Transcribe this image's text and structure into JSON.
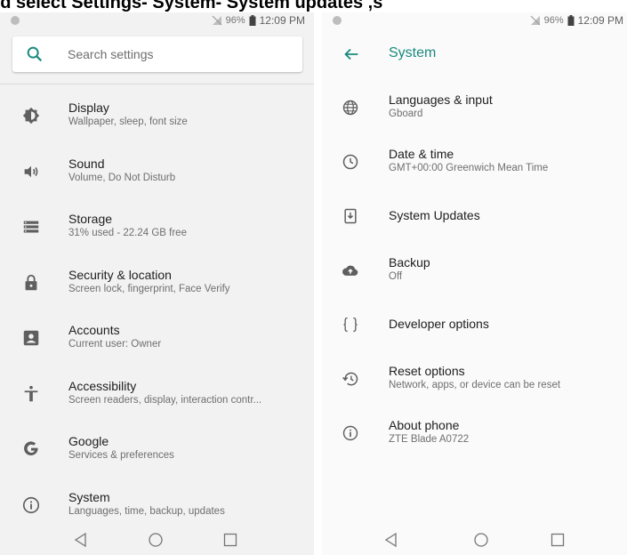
{
  "caption": "nd select Settings- System- System updates ,s",
  "status": {
    "battery": "96%",
    "time": "12:09 PM"
  },
  "left": {
    "search_placeholder": "Search settings",
    "items": [
      {
        "title": "Display",
        "sub": "Wallpaper, sleep, font size",
        "icon": "brightness-icon"
      },
      {
        "title": "Sound",
        "sub": "Volume, Do Not Disturb",
        "icon": "volume-icon"
      },
      {
        "title": "Storage",
        "sub": "31% used - 22.24 GB free",
        "icon": "storage-icon"
      },
      {
        "title": "Security & location",
        "sub": "Screen lock, fingerprint, Face Verify",
        "icon": "lock-icon"
      },
      {
        "title": "Accounts",
        "sub": "Current user: Owner",
        "icon": "account-icon"
      },
      {
        "title": "Accessibility",
        "sub": "Screen readers, display, interaction contr...",
        "icon": "accessibility-icon"
      },
      {
        "title": "Google",
        "sub": "Services & preferences",
        "icon": "google-icon"
      },
      {
        "title": "System",
        "sub": "Languages, time, backup, updates",
        "icon": "info-icon"
      }
    ]
  },
  "right": {
    "title": "System",
    "items": [
      {
        "title": "Languages & input",
        "sub": "Gboard",
        "icon": "globe-icon"
      },
      {
        "title": "Date & time",
        "sub": "GMT+00:00 Greenwich Mean Time",
        "icon": "clock-icon"
      },
      {
        "title": "System Updates",
        "sub": "",
        "icon": "system-update-icon"
      },
      {
        "title": "Backup",
        "sub": "Off",
        "icon": "cloud-upload-icon"
      },
      {
        "title": "Developer options",
        "sub": "",
        "icon": "code-braces-icon"
      },
      {
        "title": "Reset options",
        "sub": "Network, apps, or device can be reset",
        "icon": "restore-icon"
      },
      {
        "title": "About phone",
        "sub": "ZTE Blade A0722",
        "icon": "info-icon"
      }
    ]
  },
  "colors": {
    "accent": "#1a8a7e",
    "icon": "#5f5f5f",
    "background": "#f2f2f2"
  }
}
